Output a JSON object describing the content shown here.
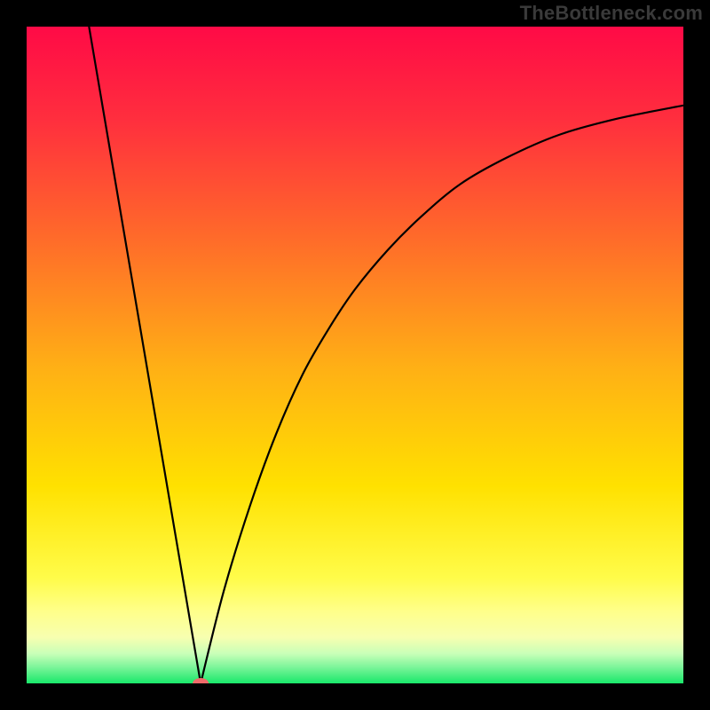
{
  "watermark": "TheBottleneck.com",
  "chart_data": {
    "type": "line",
    "title": "",
    "xlabel": "",
    "ylabel": "",
    "xlim": [
      0,
      100
    ],
    "ylim": [
      0,
      100
    ],
    "legend": false,
    "grid": false,
    "background_gradient": {
      "top": "#ff0a46",
      "middle": "#ffe100",
      "lower_band": "#ffff8a",
      "bottom": "#19e86a"
    },
    "series": [
      {
        "name": "bottleneck-curve-left",
        "x": [
          9.5,
          26.5
        ],
        "y": [
          100,
          0
        ],
        "style": "linear"
      },
      {
        "name": "bottleneck-curve-right",
        "x": [
          26.5,
          30,
          34,
          38,
          42,
          46,
          50,
          55,
          60,
          66,
          73,
          81,
          90,
          100
        ],
        "y": [
          0,
          14,
          27,
          38,
          47,
          54,
          60,
          66,
          71,
          76,
          80,
          83.5,
          86,
          88
        ]
      }
    ],
    "marker": {
      "x": 26.5,
      "y": 0,
      "color": "#f06a6a",
      "rx": 9,
      "ry": 6
    },
    "annotations": []
  }
}
